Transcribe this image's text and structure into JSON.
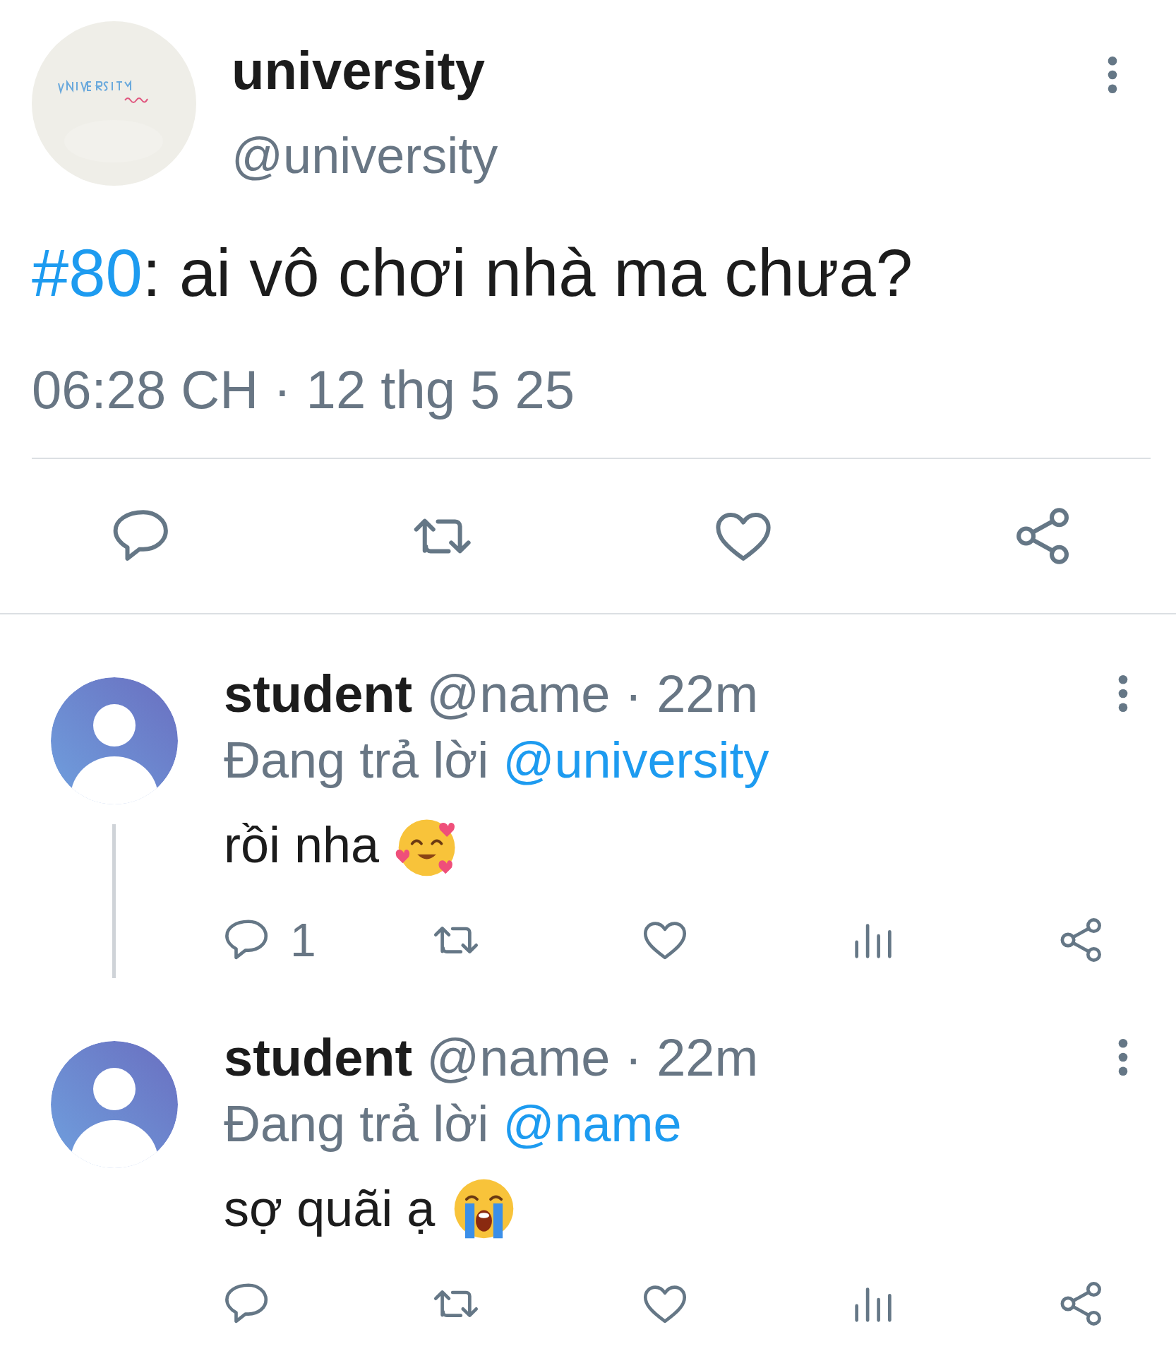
{
  "tweet": {
    "name": "university",
    "handle": "@university",
    "hashtag": "#80",
    "text": ": ai vô chơi nhà ma chưa?",
    "timestamp": "06:28 CH · 12 thg 5 25"
  },
  "replies": [
    {
      "name": "student",
      "meta": "@name · 22m",
      "reply_label": "Đang trả lời",
      "reply_to": "@university",
      "text": "rồi nha",
      "emoji": {
        "kind": "hearts"
      },
      "reply_count": "1",
      "thread": true
    },
    {
      "name": "student",
      "meta": "@name · 22m",
      "reply_label": "Đang trả lời",
      "reply_to": "@name",
      "text": "sợ quãi ạ",
      "emoji": {
        "kind": "crying"
      },
      "thread": false
    }
  ]
}
